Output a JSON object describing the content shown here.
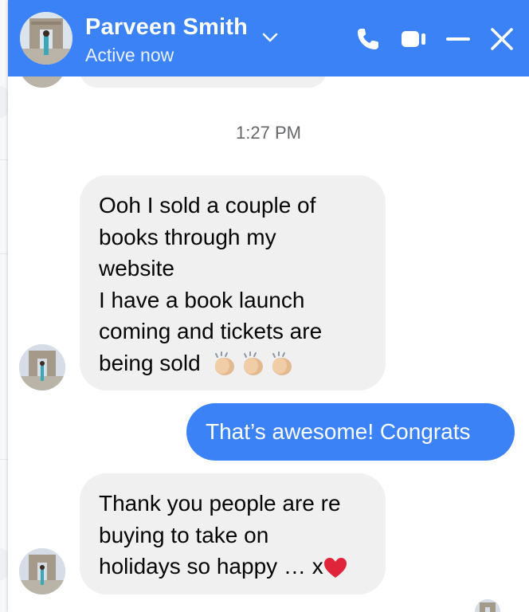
{
  "header": {
    "contact_name": "Parveen Smith",
    "status": "Active now",
    "icons": [
      "chevron-down-icon",
      "phone-icon",
      "video-icon",
      "minimize-icon",
      "close-icon"
    ],
    "color": "#3b82f6"
  },
  "messages": {
    "timestamp": "1:27 PM",
    "msg1": {
      "sender": "Parveen Smith",
      "lines": [
        "Ooh I sold a couple of",
        "books through my",
        "website",
        "I have a book launch",
        "coming and tickets are",
        "being sold"
      ],
      "emoji": [
        "clapping-hands",
        "clapping-hands",
        "clapping-hands"
      ]
    },
    "msg2": {
      "sender": "me",
      "text": "That’s awesome! Congrats"
    },
    "msg3": {
      "sender": "Parveen Smith",
      "lines": [
        "Thank you people are re",
        "buying to take on",
        "holidays so happy … x"
      ],
      "emoji": [
        "red-heart"
      ]
    }
  },
  "colors": {
    "outgoing_bubble": "#3b82f6",
    "incoming_bubble": "#f0f0f0",
    "timestamp_text": "#65676b"
  }
}
